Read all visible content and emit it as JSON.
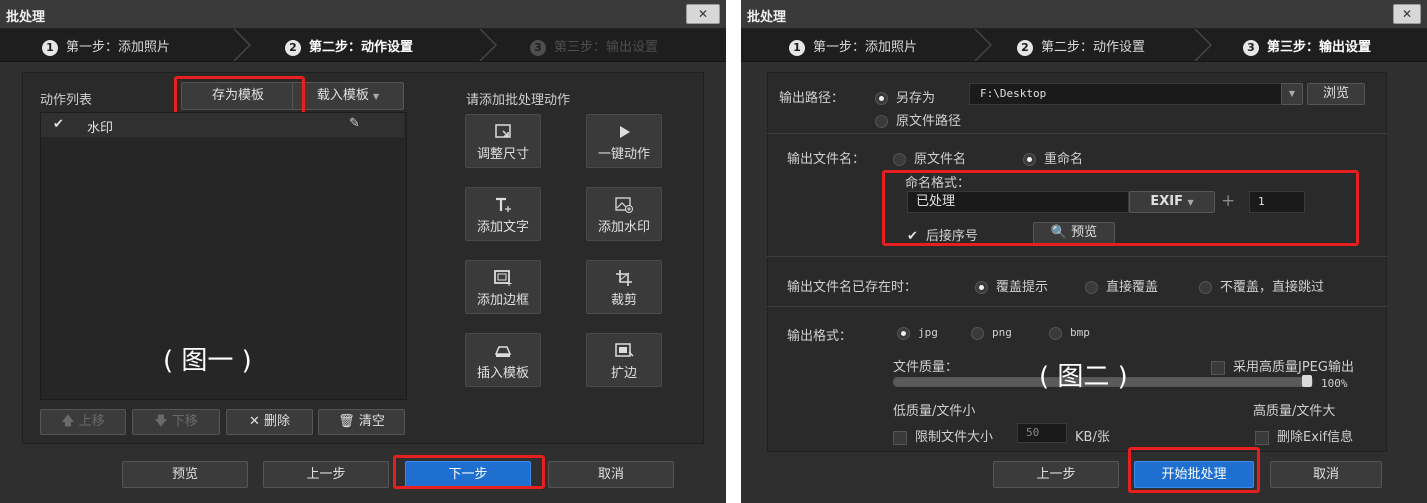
{
  "dialog_title": "批处理",
  "close_label": "✕",
  "steps": [
    {
      "num": "1",
      "label": "第一步：添加照片"
    },
    {
      "num": "2",
      "label": "第二步：动作设置"
    },
    {
      "num": "3",
      "label": "第三步：输出设置"
    }
  ],
  "panel1": {
    "action_list_label": "动作列表",
    "save_template": "存为模板",
    "load_template": "载入模板",
    "dropdown_arrow": "▼",
    "actions": [
      {
        "check": "✔",
        "name": "水印"
      }
    ],
    "edit_icon": "✎",
    "add_actions_label": "请添加批处理动作",
    "tools": [
      {
        "label": "调整尺寸",
        "icon": "resize-icon"
      },
      {
        "label": "一键动作",
        "icon": "play-icon"
      },
      {
        "label": "添加文字",
        "icon": "add-text-icon"
      },
      {
        "label": "添加水印",
        "icon": "add-watermark-icon"
      },
      {
        "label": "添加边框",
        "icon": "add-border-icon"
      },
      {
        "label": "裁剪",
        "icon": "crop-icon"
      },
      {
        "label": "插入模板",
        "icon": "insert-template-icon"
      },
      {
        "label": "扩边",
        "icon": "expand-edge-icon"
      }
    ],
    "caption": "( 图一 )",
    "list_buttons": {
      "up": "上移",
      "down": "下移",
      "delete": "删除",
      "clear": "清空"
    },
    "footer": {
      "preview": "预览",
      "prev": "上一步",
      "next": "下一步",
      "cancel": "取消"
    }
  },
  "panel2": {
    "output_path_label": "输出路径：",
    "save_as": "另存为",
    "path_value": "F:\\Desktop",
    "browse": "浏览",
    "original_path": "原文件路径",
    "output_filename_label": "输出文件名：",
    "original_name": "原文件名",
    "rename": "重命名",
    "naming_format_label": "命名格式：",
    "naming_value": "已处理",
    "exif": "EXIF",
    "plus": "+",
    "seq_start": "1",
    "suffix_seq": "后接序号",
    "preview": "预览",
    "exists_label": "输出文件名已存在时：",
    "exists_options": [
      "覆盖提示",
      "直接覆盖",
      "不覆盖，直接跳过"
    ],
    "format_label": "输出格式：",
    "formats": [
      "jpg",
      "png",
      "bmp"
    ],
    "quality_label": "文件质量：",
    "high_quality_jpeg": "采用高质量JPEG输出",
    "quality_percent": "100%",
    "quality_fraction": 1.0,
    "low_quality": "低质量/文件小",
    "high_quality": "高质量/文件大",
    "caption": "( 图二 )",
    "limit_size": "限制文件大小",
    "limit_value": "50",
    "limit_unit": "KB/张",
    "delete_exif": "删除Exif信息",
    "footer": {
      "prev": "上一步",
      "start": "开始批处理",
      "cancel": "取消"
    }
  },
  "colors": {
    "highlight": "#e81f1f",
    "primary": "#1e6fd0",
    "panel": "#2f2f2f"
  }
}
